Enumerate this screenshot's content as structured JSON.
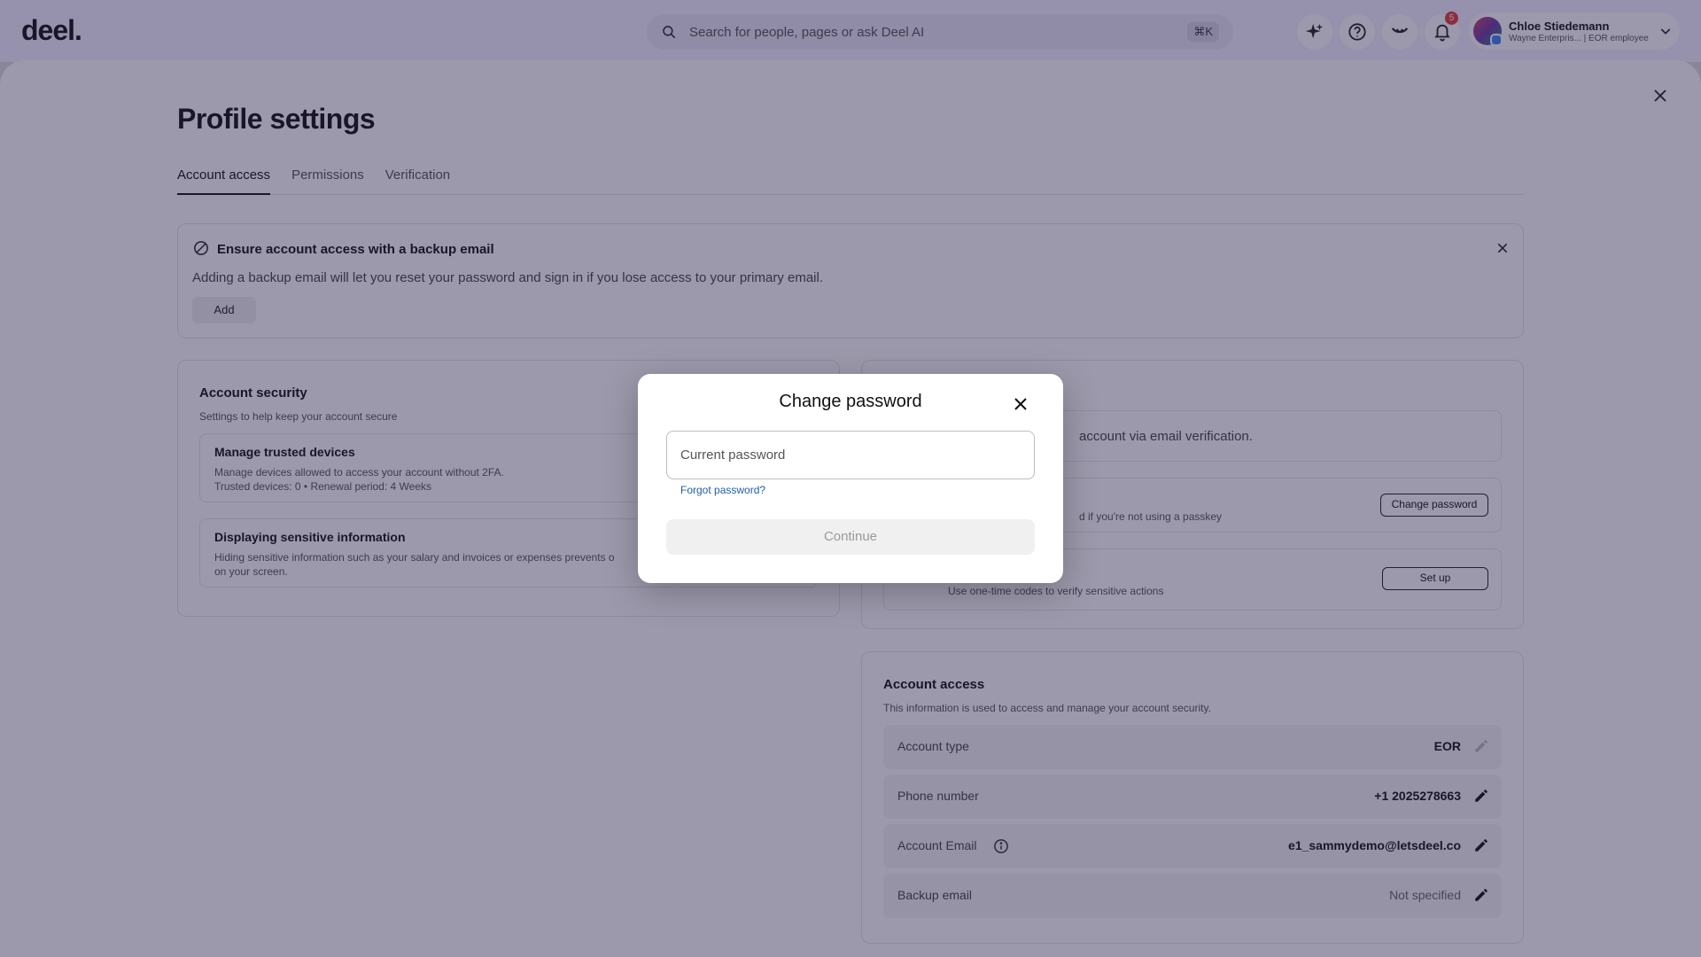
{
  "topbar": {
    "logo": "deel.",
    "search_placeholder": "Search for people, pages or ask Deel AI",
    "search_shortcut": "⌘K",
    "notification_count": "5",
    "user_name": "Chloe Stiedemann",
    "user_subtitle": "Wayne Enterpris... | EOR employee"
  },
  "page": {
    "title": "Profile settings",
    "tabs": [
      {
        "label": "Account access",
        "active": true
      },
      {
        "label": "Permissions",
        "active": false
      },
      {
        "label": "Verification",
        "active": false
      }
    ]
  },
  "banner": {
    "title": "Ensure account access with a backup email",
    "description": "Adding a backup email will let you reset your password and sign in if you lose access to your primary email.",
    "add_label": "Add"
  },
  "security": {
    "title": "Account security",
    "subtitle": "Settings to help keep your account secure",
    "trusted": {
      "title": "Manage trusted devices",
      "line1": "Manage devices allowed to access your account without 2FA.",
      "line2": "Trusted devices: 0 • Renewal period: 4 Weeks"
    },
    "sensitive": {
      "title": "Displaying sensitive information",
      "line1": "Hiding sensitive information such as your salary and invoices or expenses prevents o",
      "line2": "on your screen."
    }
  },
  "signin": {
    "email_verify_text": "account via email verification.",
    "password_desc": "d if you're not using a passkey",
    "change_password_label": "Change password",
    "otp_desc": "Use one-time codes to verify sensitive actions",
    "setup_label": "Set up"
  },
  "account_access": {
    "title": "Account access",
    "subtitle": "This information is used to access and manage your account security.",
    "rows": [
      {
        "label": "Account type",
        "value": "EOR"
      },
      {
        "label": "Phone number",
        "value": "+1 2025278663"
      },
      {
        "label": "Account Email",
        "value": "e1_sammydemo@letsdeel.co"
      },
      {
        "label": "Backup email",
        "value": "Not specified"
      }
    ]
  },
  "modal": {
    "title": "Change password",
    "current_password_placeholder": "Current password",
    "forgot_label": "Forgot password?",
    "continue_label": "Continue"
  }
}
